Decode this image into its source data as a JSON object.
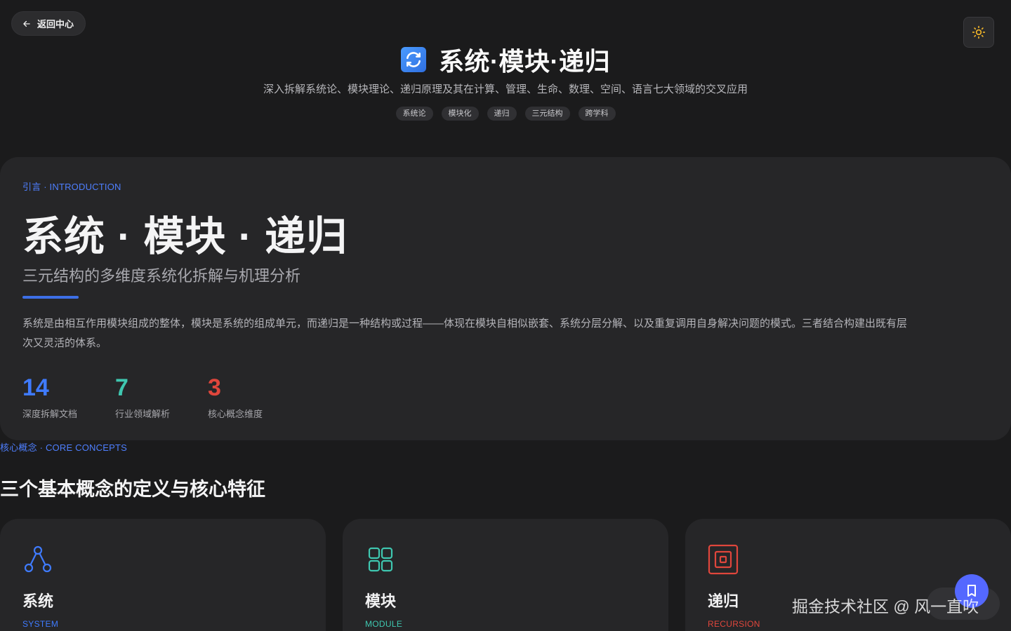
{
  "nav": {
    "back_label": "返回中心",
    "theme_icon": "sun-icon"
  },
  "hero": {
    "title": "系统·模块·递归",
    "description": "深入拆解系统论、模块理论、递归原理及其在计算、管理、生命、数理、空间、语言七大领域的交叉应用",
    "tags": [
      "系统论",
      "模块化",
      "递归",
      "三元结构",
      "跨学科"
    ]
  },
  "intro": {
    "kicker": "引言 · INTRODUCTION",
    "title": "系统 · 模块 · 递归",
    "subtitle": "三元结构的多维度系统化拆解与机理分析",
    "body": "系统是由相互作用模块组成的整体，模块是系统的组成单元，而递归是一种结构或过程——体现在模块自相似嵌套、系统分层分解、以及重复调用自身解决问题的模式。三者结合构建出既有层次又灵活的体系。",
    "stats": [
      {
        "value": "14",
        "label": "深度拆解文档",
        "color": "#3f7bff"
      },
      {
        "value": "7",
        "label": "行业领域解析",
        "color": "#3fc7b0"
      },
      {
        "value": "3",
        "label": "核心概念维度",
        "color": "#e0463c"
      }
    ]
  },
  "core": {
    "kicker": "核心概念 · CORE CONCEPTS",
    "title": "三个基本概念的定义与核心特征",
    "cards": [
      {
        "name": "系统",
        "en": "SYSTEM",
        "color": "#3f7bff",
        "icon": "network-icon"
      },
      {
        "name": "模块",
        "en": "MODULE",
        "color": "#3fc7b0",
        "icon": "grid-icon"
      },
      {
        "name": "递归",
        "en": "RECURSION",
        "color": "#e0463c",
        "icon": "nested-square-icon"
      }
    ]
  },
  "watermark": "掘金技术社区 @ 风一直吹",
  "colors": {
    "accent": "#3d6fe6",
    "background": "#1b1b1c",
    "card": "#262628"
  }
}
